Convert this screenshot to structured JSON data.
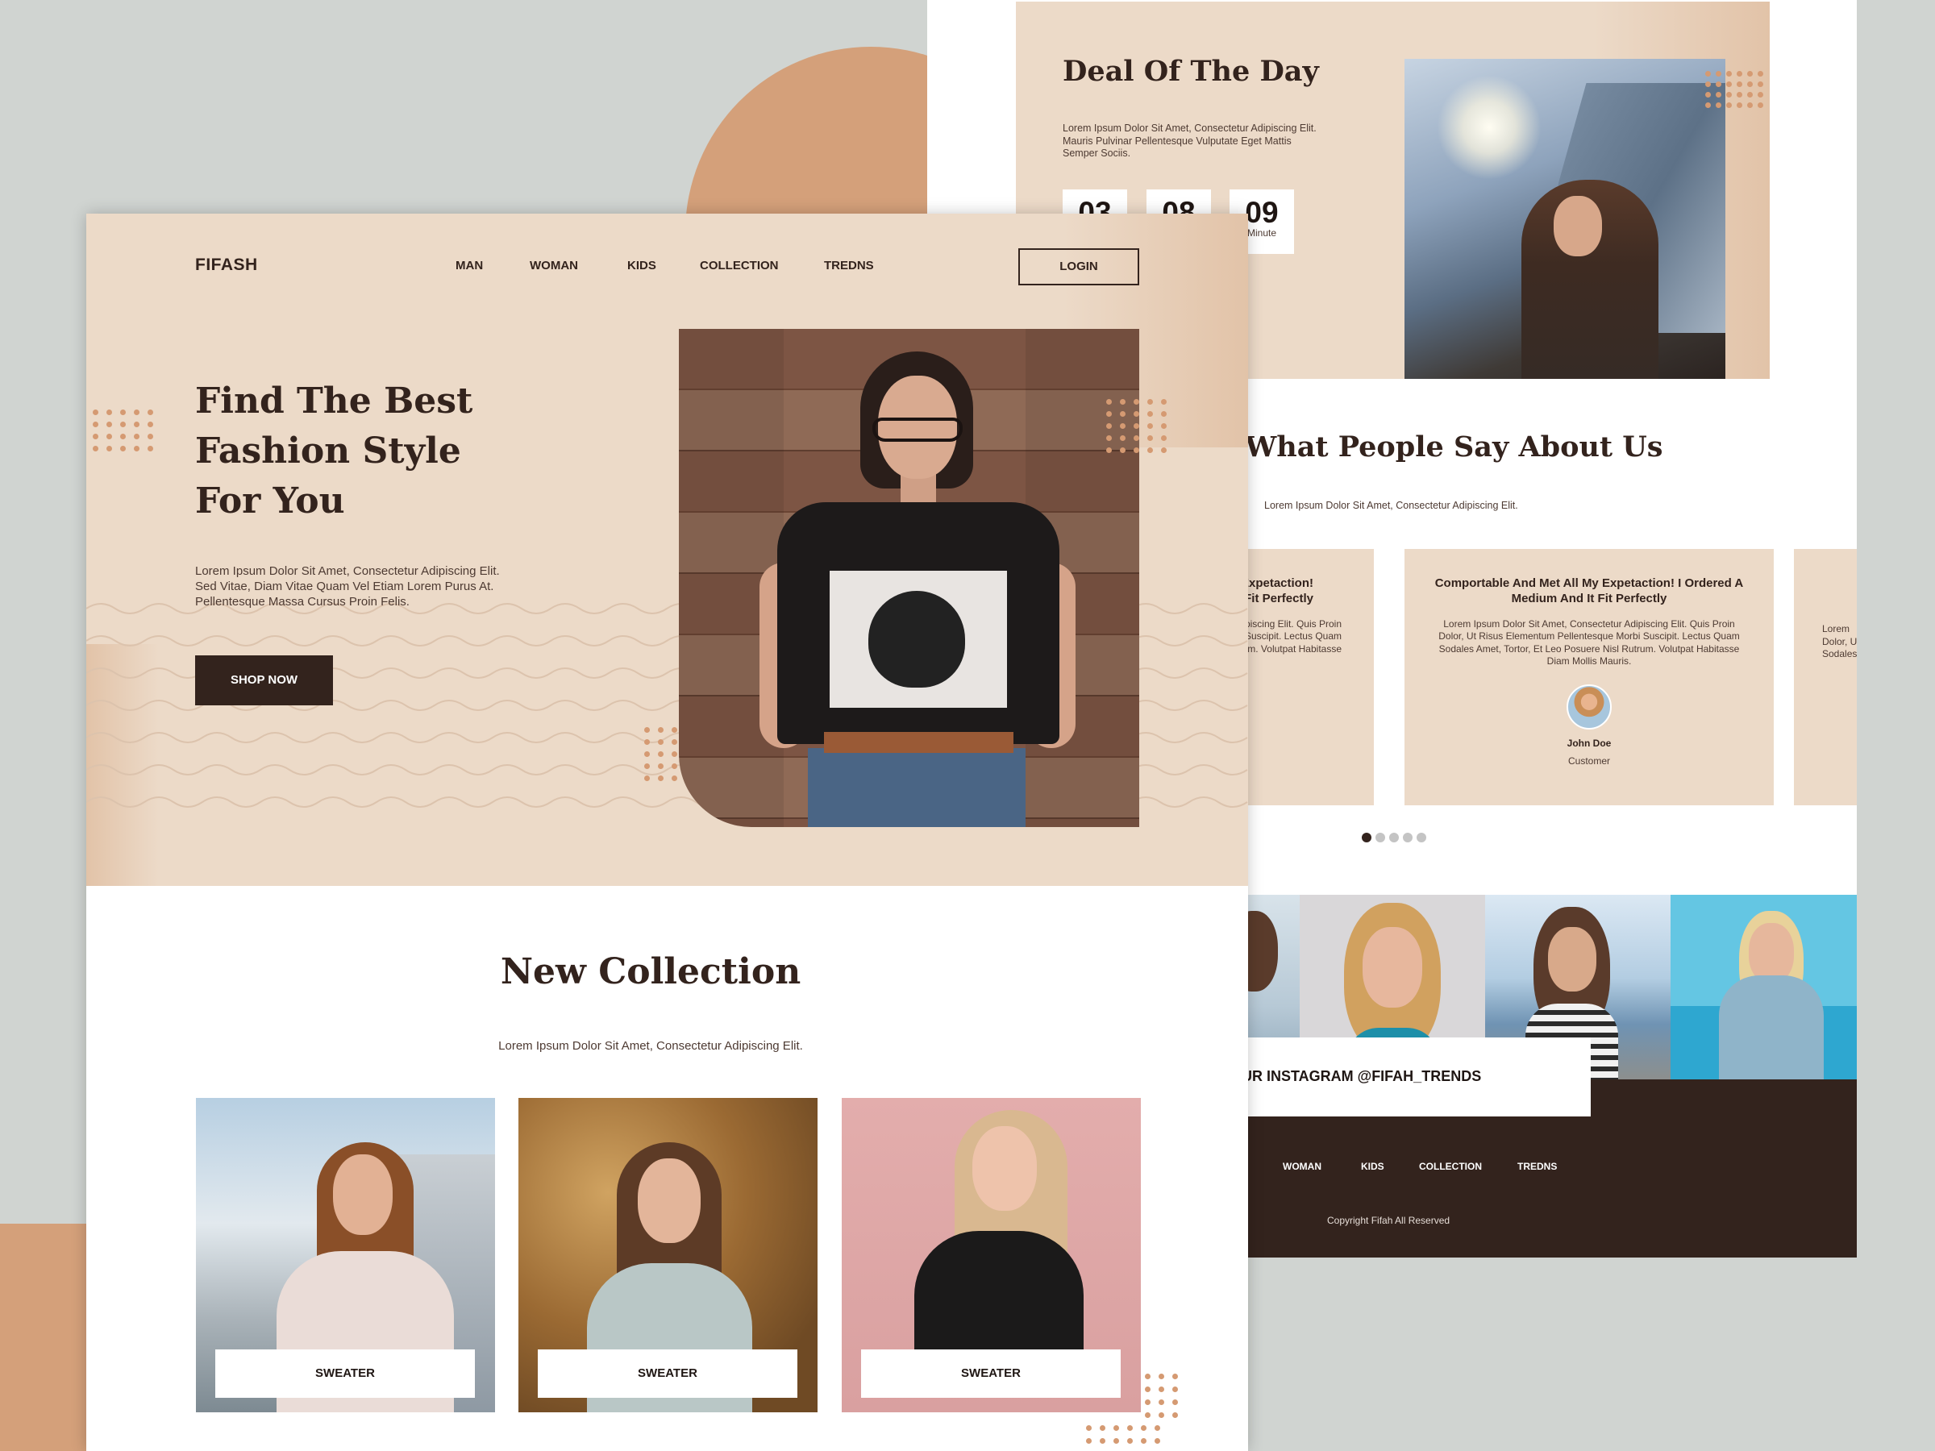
{
  "brand": "FIFASH",
  "nav": [
    "MAN",
    "WOMAN",
    "KIDS",
    "COLLECTION",
    "TREDNS"
  ],
  "login_label": "LOGIN",
  "hero": {
    "headline_lines": [
      "Find The Best",
      "Fashion Style",
      "For You"
    ],
    "text": "Lorem Ipsum Dolor Sit Amet, Consectetur Adipiscing Elit. Sed Vitae, Diam Vitae Quam Vel Etiam Lorem Purus At. Pellentesque Massa Cursus Proin Felis.",
    "cta": "SHOP NOW"
  },
  "collection": {
    "title": "New Collection",
    "subtitle": "Lorem Ipsum Dolor Sit Amet, Consectetur Adipiscing Elit.",
    "products": [
      {
        "label": "SWEATER"
      },
      {
        "label": "SWEATER"
      },
      {
        "label": "SWEATER"
      }
    ]
  },
  "deal": {
    "title": "Deal Of The Day",
    "text": "Lorem Ipsum Dolor Sit Amet, Consectetur Adipiscing Elit. Mauris Pulvinar Pellentesque Vulputate Eget Mattis Semper Sociis.",
    "countdown": [
      {
        "value": "03",
        "unit": ""
      },
      {
        "value": "08",
        "unit": ""
      },
      {
        "value": "09",
        "unit": "Minute"
      }
    ]
  },
  "testimonials": {
    "title": "What People Say About Us",
    "subtitle": "Lorem Ipsum Dolor Sit Amet, Consectetur Adipiscing Elit.",
    "cards": [
      {
        "heading": "Comportable And Met All My Expetaction! I Ordered A Medium And It Fit Perfectly",
        "text": "Lorem Ipsum Dolor Sit Amet, Consectetur Adipiscing Elit. Quis Proin Dolor, Ut Risus Elementum Pellentesque Morbi Suscipit. Lectus Quam Sodales Amet, Tortor, Et Leo Posuere Nisl Rutrum. Volutpat Habitasse Diam Mollis Mauris.",
        "name": "John Doe",
        "role": "Customer"
      }
    ],
    "left_card_heading": "Expetaction!\nFit Perfectly",
    "left_card_text": "dipiscing Elit. Quis Proin\nbi Suscipit. Lectus Quam\nrum. Volutpat Habitasse",
    "right_card_text": "Lorem\nDolor, U\nSodales",
    "pager_count": 5,
    "pager_active": 0
  },
  "instagram": {
    "label": "FOLLOW OUR INSTAGRAM @FIFAH_TRENDS"
  },
  "footer": {
    "nav": [
      "WOMAN",
      "KIDS",
      "COLLECTION",
      "TREDNS"
    ],
    "copyright": "Copyright Fifah All Reserved"
  },
  "colors": {
    "accent": "#d4a07a",
    "dark": "#33231d",
    "cream": "#ecdac8",
    "backdrop": "#d0d4d1"
  }
}
